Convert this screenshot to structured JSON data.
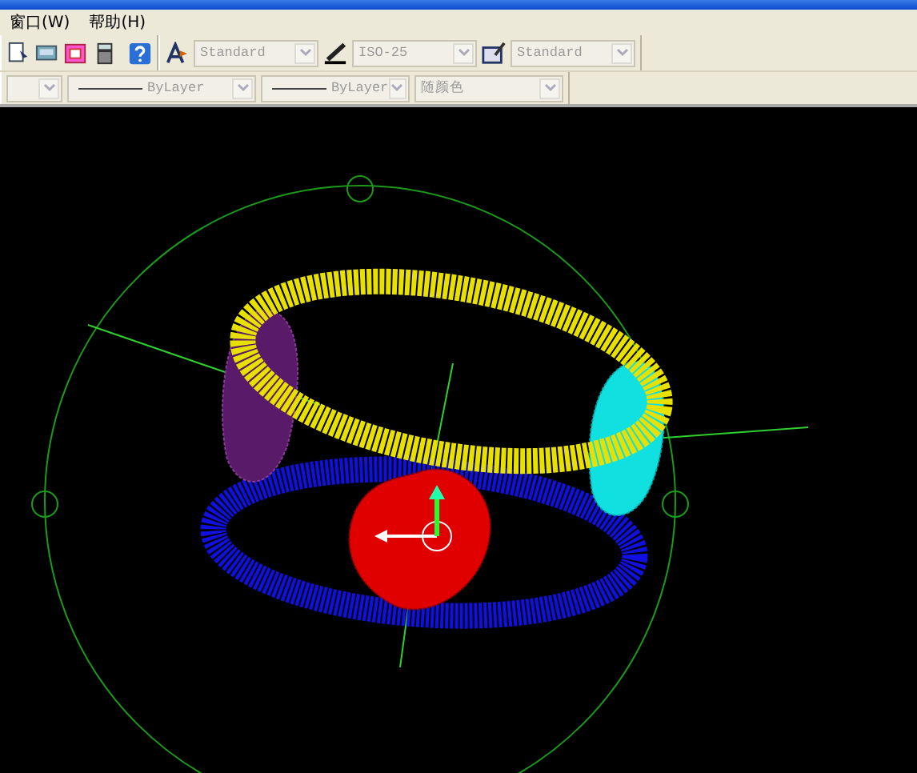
{
  "menu": [
    {
      "label": "窗口(W)"
    },
    {
      "label": "帮助(H)"
    }
  ],
  "toolbar_styles": [
    {
      "kind": "text",
      "value": "Standard"
    },
    {
      "kind": "dim",
      "value": "ISO-25"
    },
    {
      "kind": "table",
      "value": "Standard"
    }
  ],
  "toolbar_properties": [
    {
      "kind": "plain"
    },
    {
      "kind": "line",
      "value": "ByLayer"
    },
    {
      "kind": "line",
      "value": "ByLayer"
    },
    {
      "kind": "plain",
      "value": "随颜色"
    }
  ]
}
